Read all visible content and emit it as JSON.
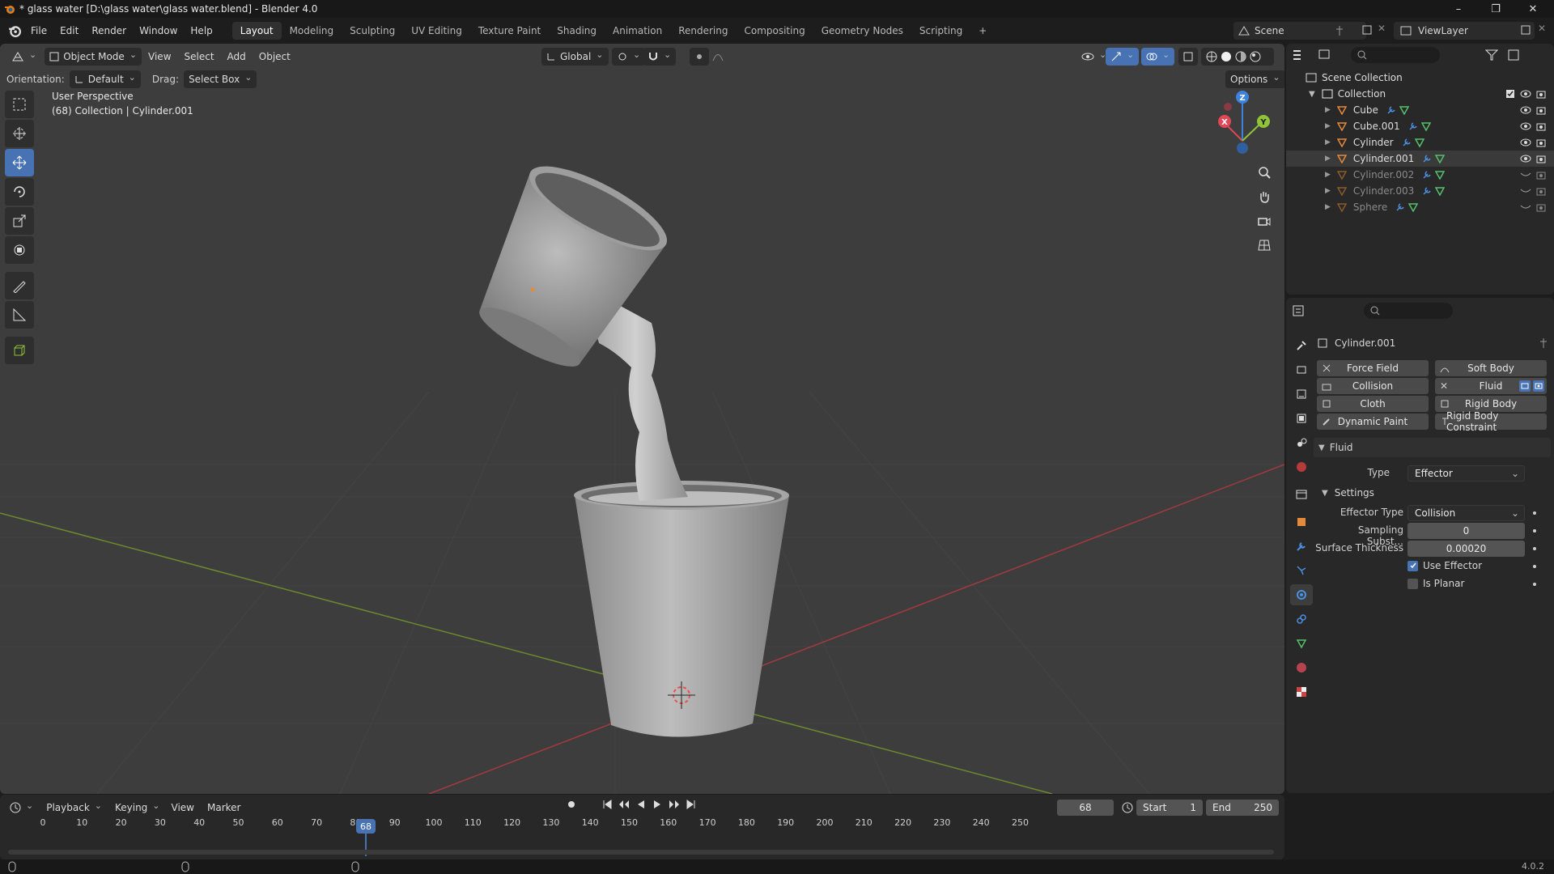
{
  "window": {
    "title": "* glass water [D:\\glass water\\glass water.blend] - Blender 4.0"
  },
  "menus": [
    "File",
    "Edit",
    "Render",
    "Window",
    "Help"
  ],
  "workspaces": [
    "Layout",
    "Modeling",
    "Sculpting",
    "UV Editing",
    "Texture Paint",
    "Shading",
    "Animation",
    "Rendering",
    "Compositing",
    "Geometry Nodes",
    "Scripting"
  ],
  "active_workspace": "Layout",
  "scene": {
    "name": "Scene",
    "view_layer": "ViewLayer"
  },
  "viewport": {
    "mode": "Object Mode",
    "header_menus": [
      "View",
      "Select",
      "Add",
      "Object"
    ],
    "transform_orientation": "Global",
    "orientation_label": "Orientation:",
    "orientation_value": "Default",
    "drag_label": "Drag:",
    "drag_value": "Select Box",
    "options": "Options",
    "info_line1": "User Perspective",
    "info_line2": "(68) Collection | Cylinder.001",
    "axis_labels": {
      "x": "X",
      "y": "Y",
      "z": "Z"
    }
  },
  "outliner": {
    "root": "Scene Collection",
    "collection": "Collection",
    "items": [
      {
        "name": "Cube",
        "hidden": false
      },
      {
        "name": "Cube.001",
        "hidden": false
      },
      {
        "name": "Cylinder",
        "hidden": false
      },
      {
        "name": "Cylinder.001",
        "hidden": false,
        "active": true
      },
      {
        "name": "Cylinder.002",
        "hidden": true
      },
      {
        "name": "Cylinder.003",
        "hidden": true
      },
      {
        "name": "Sphere",
        "hidden": true
      }
    ]
  },
  "properties": {
    "object_name": "Cylinder.001",
    "physics_buttons": {
      "force_field": "Force Field",
      "soft_body": "Soft Body",
      "collision": "Collision",
      "fluid": "Fluid",
      "cloth": "Cloth",
      "rigid_body": "Rigid Body",
      "dynamic_paint": "Dynamic Paint",
      "rigid_body_constraint": "Rigid Body Constraint"
    },
    "fluid_panel": "Fluid",
    "type_label": "Type",
    "type_value": "Effector",
    "settings_panel": "Settings",
    "effector_type_label": "Effector Type",
    "effector_type_value": "Collision",
    "sampling_label": "Sampling Subst...",
    "sampling_value": "0",
    "thickness_label": "Surface Thickness",
    "thickness_value": "0.00020",
    "use_effector_label": "Use Effector",
    "use_effector": true,
    "is_planar_label": "Is Planar",
    "is_planar": false
  },
  "timeline": {
    "menus": [
      "Playback",
      "Keying",
      "View",
      "Marker"
    ],
    "current_frame": "68",
    "start_label": "Start",
    "start": "1",
    "end_label": "End",
    "end": "250",
    "ticks": [
      "0",
      "10",
      "20",
      "30",
      "40",
      "50",
      "60",
      "70",
      "80",
      "90",
      "100",
      "110",
      "120",
      "130",
      "140",
      "150",
      "160",
      "170",
      "180",
      "190",
      "200",
      "210",
      "220",
      "230",
      "240",
      "250"
    ],
    "frame_indicator": "68"
  },
  "status": {
    "version": "4.0.2"
  },
  "colors": {
    "accent": "#4772b3",
    "x_axis": "#e04858",
    "y_axis": "#8fc43a",
    "z_axis": "#3d82dc",
    "mesh": "#e58a3a"
  }
}
